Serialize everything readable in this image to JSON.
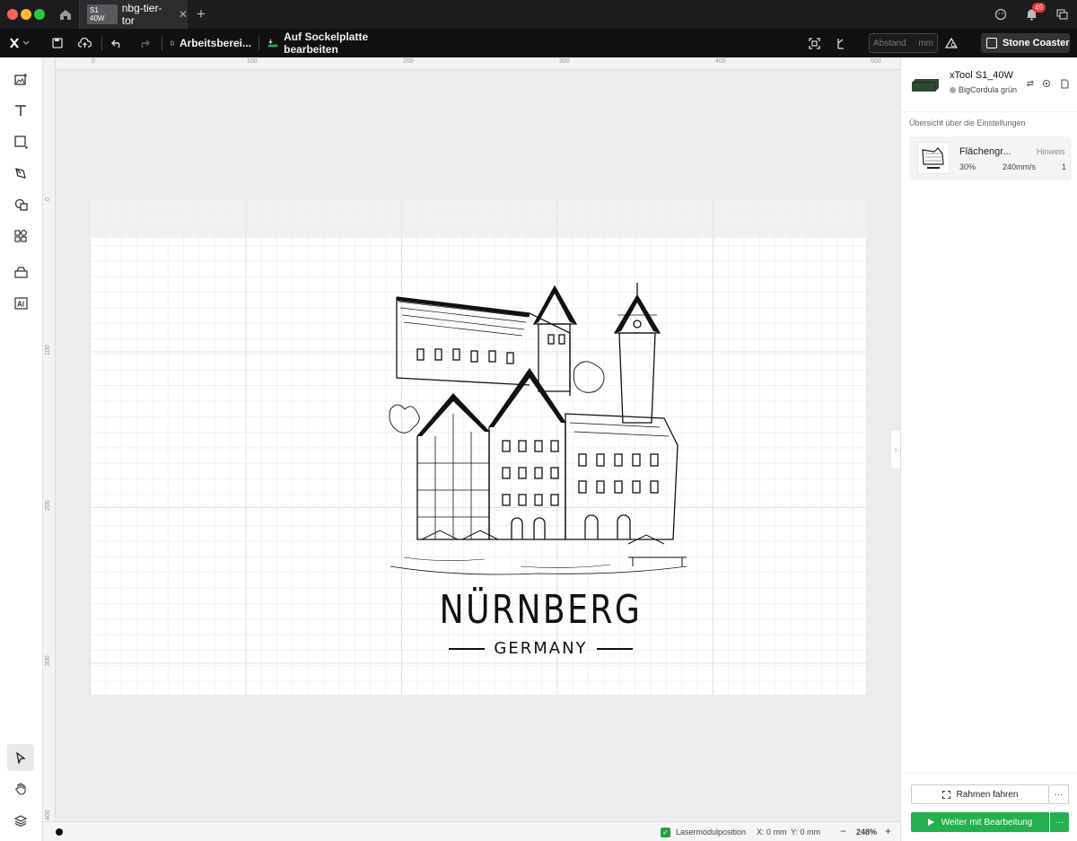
{
  "titlebar": {
    "tab_badge": "S1 40W",
    "tab_title": "nbg-tier-tor",
    "tab_close": "✕",
    "tab_add": "+",
    "notification_count": "49"
  },
  "toolbar": {
    "workspace_label": "Arbeitsberei...",
    "base_plate_label": "Auf Sockelplatte bearbeiten",
    "distance_placeholder": "Abstand",
    "distance_unit": "mm",
    "material_label": "Stone Coaster"
  },
  "rulers": {
    "top": [
      "0",
      "100",
      "200",
      "300",
      "400",
      "500"
    ],
    "left": [
      "0",
      "100",
      "200",
      "300",
      "400"
    ]
  },
  "artwork": {
    "title": "NÜRNBERG",
    "subtitle": "GERMANY"
  },
  "status": {
    "laser_label": "Lasermodulposition",
    "x": "X: 0 mm",
    "y": "Y: 0 mm",
    "zoom_minus": "−",
    "zoom": "248%",
    "zoom_plus": "+"
  },
  "panel": {
    "device_name": "xTool S1_40W",
    "material_name": "BigCordula grün",
    "overview_label": "Übersicht über die Einstellungen",
    "layer": {
      "name": "Flächengr...",
      "hint": "Hinweis",
      "power": "30%",
      "speed": "240mm/s",
      "passes": "1"
    },
    "frame_label": "Rahmen fahren",
    "process_label": "Weiter mit Bearbeitung",
    "more": "···"
  },
  "colors": {
    "accent_green": "#22b14c",
    "titlebar_bg": "#1c1c1e",
    "toolbar_bg": "#111111",
    "notification_red": "#ee3333"
  }
}
